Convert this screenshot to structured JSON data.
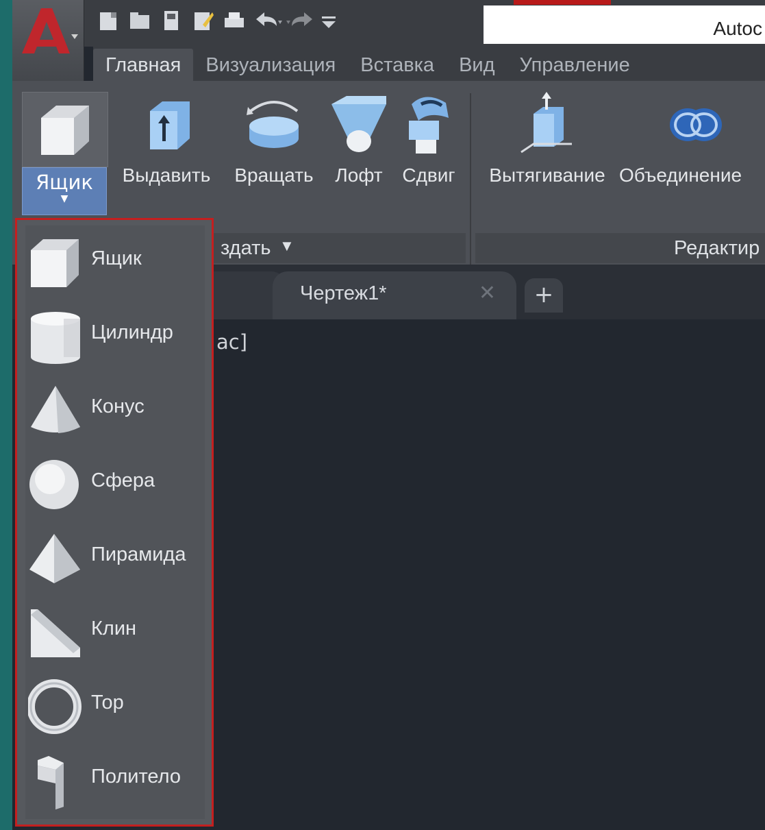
{
  "titlebar": {
    "title_partial": "Autoc"
  },
  "quick_access": [
    "new-icon",
    "open-icon",
    "save-icon",
    "save-as-icon",
    "print-icon",
    "undo-icon",
    "redo-icon",
    "customize-icon"
  ],
  "ribbon_tabs": [
    "Главная",
    "Визуализация",
    "Вставка",
    "Вид",
    "Управление"
  ],
  "ribbon": {
    "box_split_label": "Ящик",
    "buttons": [
      "Выдавить",
      "Вращать",
      "Лофт",
      "Сдвиг",
      "Вытягивание",
      "Объединение"
    ],
    "panel_create": "здать",
    "panel_edit": "Редактир"
  },
  "doc_tabs": {
    "active_label": "Чертеж1*",
    "add_label": "+"
  },
  "viewport": {
    "visible_text": "ac]"
  },
  "dropdown": {
    "items": [
      "Ящик",
      "Цилиндр",
      "Конус",
      "Сфера",
      "Пирамида",
      "Клин",
      "Тор",
      "Политело"
    ]
  },
  "colors": {
    "accent_red": "#c41f1f",
    "ribbon_bg": "#4d5056",
    "viewport_bg": "#22272f",
    "split_blue": "#5d7fb5"
  }
}
